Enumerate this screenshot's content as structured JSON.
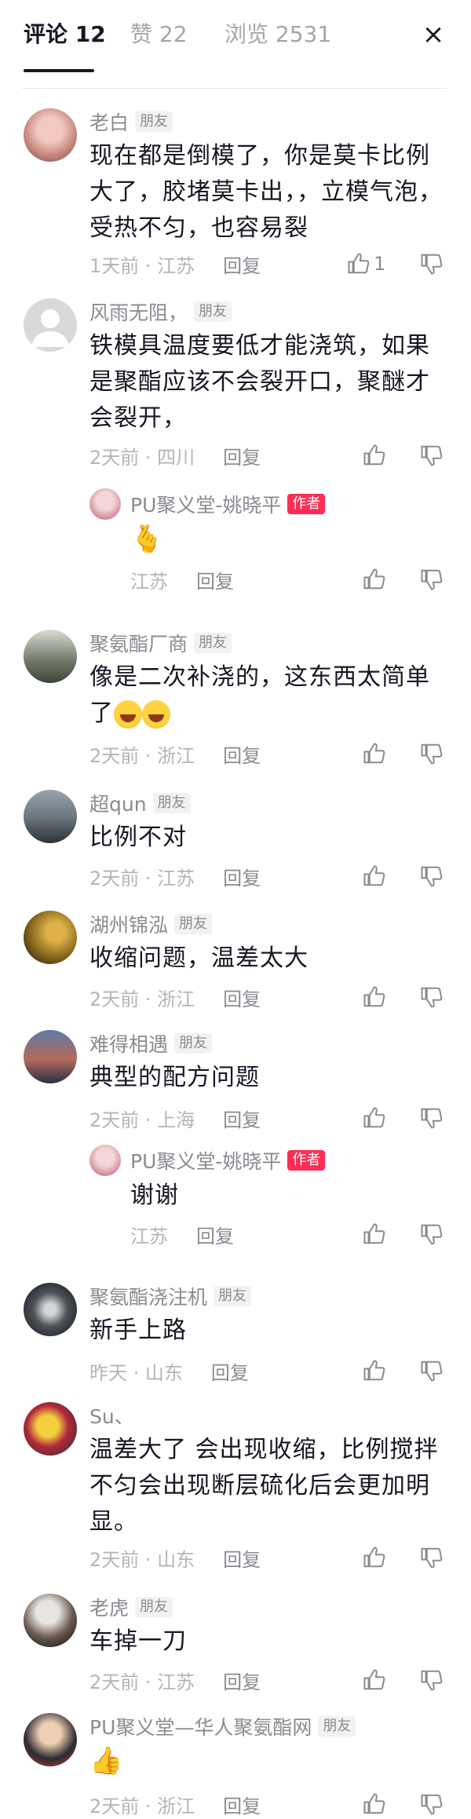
{
  "header": {
    "tabs": [
      {
        "label": "评论 12"
      },
      {
        "label": "赞 22"
      },
      {
        "label": "浏览 2531"
      }
    ],
    "close_icon": "×"
  },
  "comments": [
    {
      "name": "老白",
      "badge": "朋友",
      "text": "现在都是倒模了，你是莫卡比例大了，胶堵莫卡出，，立模气泡，受热不匀，也容易裂",
      "meta": "1天前 · 江苏",
      "reply": "回复",
      "likes": "1"
    },
    {
      "name": "风雨无阻，",
      "badge": "朋友",
      "text": "铁模具温度要低才能浇筑，如果是聚酯应该不会裂开口，聚醚才会裂开，",
      "meta": "2天前 · 四川",
      "reply": "回复"
    },
    {
      "name": "PU聚义堂-姚晓平",
      "badge": "作者",
      "text": "🫰",
      "meta": "江苏",
      "reply": "回复"
    },
    {
      "name": "聚氨酯厂商",
      "badge": "朋友",
      "text": "像是二次补浇的，这东西太简单了",
      "meta": "2天前 · 浙江",
      "reply": "回复"
    },
    {
      "name": "超qun",
      "badge": "朋友",
      "text": "比例不对",
      "meta": "2天前 · 江苏",
      "reply": "回复"
    },
    {
      "name": "湖州锦泓",
      "badge": "朋友",
      "text": "收缩问题，温差太大",
      "meta": "2天前 · 浙江",
      "reply": "回复"
    },
    {
      "name": "难得相遇",
      "badge": "朋友",
      "text": "典型的配方问题",
      "meta": "2天前 · 上海",
      "reply": "回复"
    },
    {
      "name": "PU聚义堂-姚晓平",
      "badge": "作者",
      "text": "谢谢",
      "meta": "江苏",
      "reply": "回复"
    },
    {
      "name": "聚氨酯浇注机",
      "badge": "朋友",
      "text": "新手上路",
      "meta": "昨天 · 山东",
      "reply": "回复"
    },
    {
      "name": "Su、",
      "badge": "",
      "text": "温差大了 会出现收缩，比例搅拌不匀会出现断层硫化后会更加明显。",
      "meta": "2天前 · 山东",
      "reply": "回复"
    },
    {
      "name": "老虎",
      "badge": "朋友",
      "text": "车掉一刀",
      "meta": "2天前 · 江苏",
      "reply": "回复"
    },
    {
      "name": "PU聚义堂—华人聚氨酯网",
      "badge": "朋友",
      "text": "👍",
      "meta": "2天前 · 浙江",
      "reply": "回复"
    }
  ]
}
